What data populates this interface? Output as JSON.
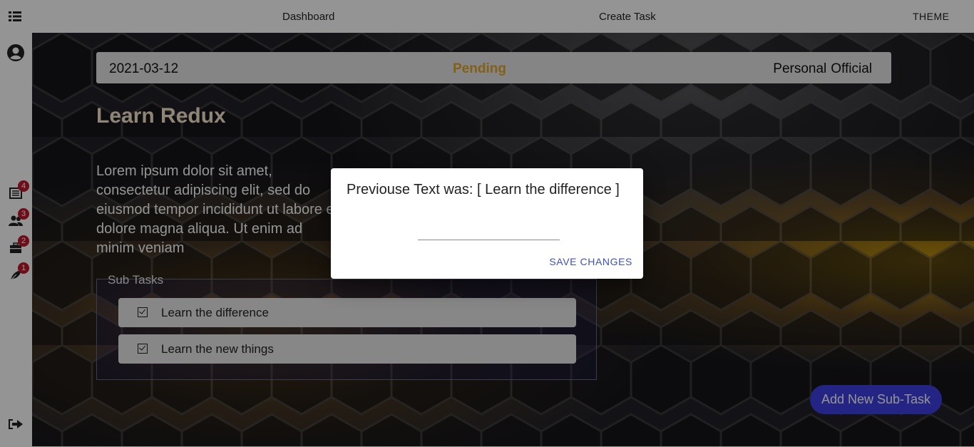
{
  "topbar": {
    "menu_icon": "list-icon",
    "nav": [
      "Dashboard",
      "Create Task"
    ],
    "theme_label": "THEME"
  },
  "sidebar": {
    "profile_icon": "user-circle-icon",
    "items": [
      {
        "icon": "task-list-icon",
        "badge": "4"
      },
      {
        "icon": "people-icon",
        "badge": "3"
      },
      {
        "icon": "briefcase-icon",
        "badge": "2"
      },
      {
        "icon": "leaf-icon",
        "badge": "1"
      }
    ],
    "logout_icon": "logout-icon"
  },
  "task": {
    "date": "2021-03-12",
    "status": "Pending",
    "categories": [
      "Personal",
      "Official"
    ],
    "title": "Learn Redux",
    "description": "Lorem ipsum dolor sit amet, consectetur adipiscing elit, sed do eiusmod tempor incididunt ut labore et dolore magna aliqua. Ut enim ad minim veniam"
  },
  "subtasks": {
    "legend": "Sub Tasks",
    "items": [
      "Learn the difference",
      "Learn the new things"
    ]
  },
  "add_button": "Add New Sub-Task",
  "dialog": {
    "previous_text": "Previouse Text was: [ Learn the difference ]",
    "input_value": "",
    "save_label": "SAVE CHANGES"
  },
  "colors": {
    "status": "#e1a52a",
    "accent": "#3f3fe6",
    "save": "#3f51b5",
    "badge": "#c0182a"
  }
}
